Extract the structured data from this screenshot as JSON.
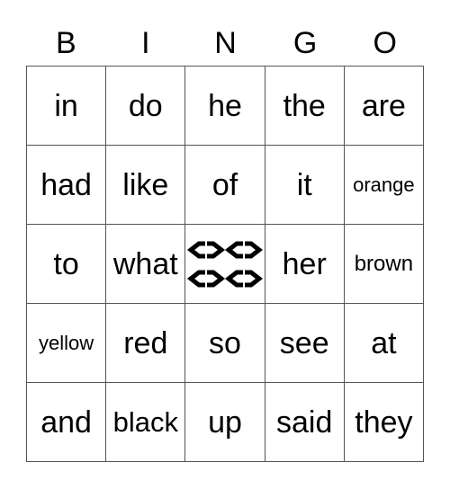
{
  "header": {
    "letters": [
      "B",
      "I",
      "N",
      "G",
      "O"
    ]
  },
  "card": {
    "rows": [
      [
        "in",
        "do",
        "he",
        "the",
        "are"
      ],
      [
        "had",
        "like",
        "of",
        "it",
        "orange"
      ],
      [
        "to",
        "what",
        "FREE",
        "her",
        "brown"
      ],
      [
        "yellow",
        "red",
        "so",
        "see",
        "at"
      ],
      [
        "and",
        "black",
        "up",
        "said",
        "they"
      ]
    ],
    "free_space": {
      "icon": "diamond-pattern-icon",
      "position": [
        2,
        2
      ]
    }
  }
}
